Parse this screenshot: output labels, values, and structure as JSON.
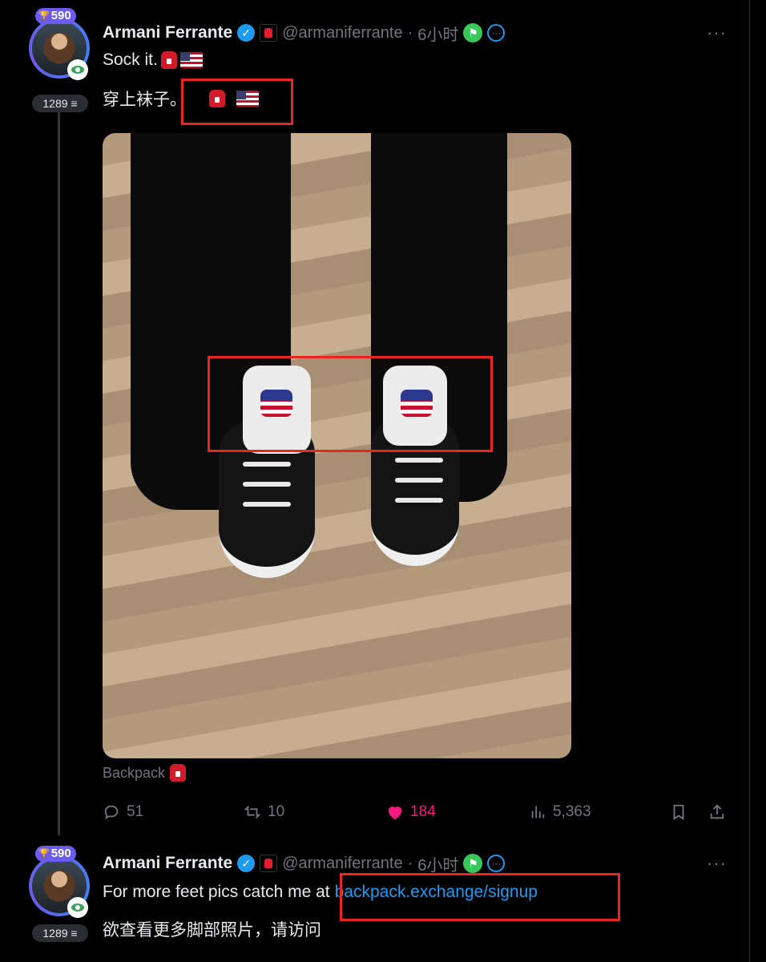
{
  "tweets": [
    {
      "score": "590",
      "count": "1289",
      "author_name": "Armani Ferrante",
      "handle": "@armaniferrante",
      "separator": "·",
      "time": "6小时",
      "more": "···",
      "text_line1": "Sock it.",
      "text_line2": "穿上袜子。",
      "image_caption": "Backpack",
      "actions": {
        "replies": "51",
        "retweets": "10",
        "likes": "184",
        "views": "5,363"
      }
    },
    {
      "score": "590",
      "count": "1289",
      "author_name": "Armani Ferrante",
      "handle": "@armaniferrante",
      "separator": "·",
      "time": "6小时",
      "more": "···",
      "text_prefix": "For more feet pics catch me at",
      "link_text": "backpack.exchange/signup",
      "text_line2": "欲查看更多脚部照片，请访问"
    }
  ],
  "colors": {
    "background": "#000000",
    "accent": "#1d9bf0",
    "like": "#f91880",
    "annotation": "#e6261f"
  },
  "icons": [
    "trophy-icon",
    "eye-badge-icon",
    "verified-icon",
    "affiliate-badge-icon",
    "flag-badge-icon",
    "info-circle-icon",
    "backpack-emoji-icon",
    "us-flag-emoji-icon",
    "reply-icon",
    "retweet-icon",
    "like-icon",
    "views-icon",
    "bookmark-icon",
    "share-icon"
  ]
}
